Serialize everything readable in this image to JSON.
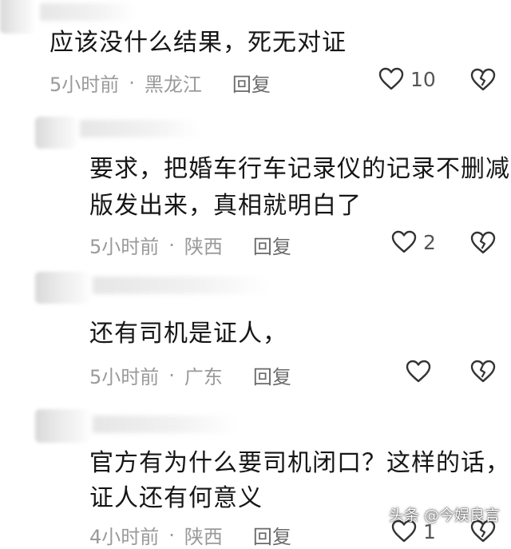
{
  "comments": [
    {
      "text_lines": [
        "应该没什么结果，死无对证"
      ],
      "time": "5小时前",
      "location": "黑龙江",
      "reply_label": "回复",
      "likes": "10"
    },
    {
      "text_lines": [
        "要求，把婚车行车记录仪的记录不删减",
        "版发出来，真相就明白了"
      ],
      "time": "5小时前",
      "location": "陕西",
      "reply_label": "回复",
      "likes": "2"
    },
    {
      "text_lines": [
        "还有司机是证人，"
      ],
      "time": "5小时前",
      "location": "广东",
      "reply_label": "回复",
      "likes": ""
    },
    {
      "text_lines": [
        "官方有为什么要司机闭口？这样的话，",
        "证人还有何意义"
      ],
      "time": "4小时前",
      "location": "陕西",
      "reply_label": "回复",
      "likes": "1"
    }
  ],
  "separator": "·",
  "watermark": "头条 @今娱良言",
  "colors": {
    "text": "#161616",
    "meta": "#9a9a9a",
    "icon_stroke": "#333333"
  },
  "icons": {
    "like": "heart-outline-icon",
    "dislike": "broken-heart-icon"
  }
}
